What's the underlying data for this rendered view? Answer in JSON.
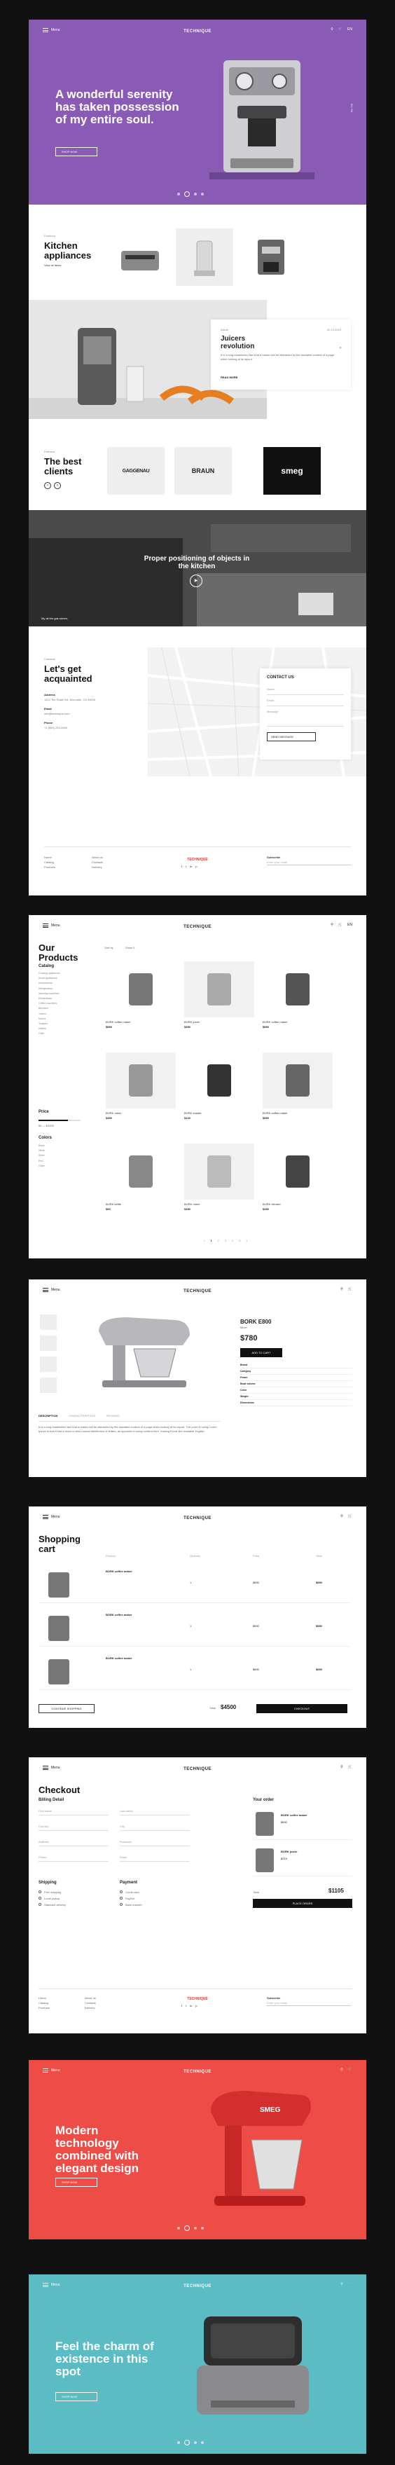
{
  "colors": {
    "purple": "#8a5bb5",
    "red": "#ee4c47",
    "teal": "#5bbcc4",
    "dark": "#111111",
    "accent_red": "#e53935"
  },
  "nav": {
    "logo": "TECHNIQUE",
    "menu": "Menu",
    "search_icon": "search-icon",
    "cart_icon": "cart-icon",
    "cart_count": "2",
    "lang": "EN"
  },
  "hero1": {
    "title": "A wonderful serenity has taken possession of my entire soul.",
    "button": "SHOP NOW",
    "counter": "01 / 04"
  },
  "kitchen": {
    "eyebrow": "Featured",
    "title": "Kitchen appliances",
    "link": "View all items"
  },
  "juicers": {
    "eyebrow": "Article",
    "date": "02.10.2019",
    "title": "Juicers revolution",
    "text": "It is a long established fact that a reader will be distracted by the readable content of a page when looking at its layout.",
    "link": "READ MORE"
  },
  "clients": {
    "eyebrow": "Partners",
    "title": "The best clients",
    "logos": [
      "GAGGENAU",
      "BRAUN",
      "smeg"
    ]
  },
  "kitchen_banner": {
    "title": "Proper positioning of objects in the kitchen",
    "caption": "My all the gas stoves"
  },
  "contact": {
    "eyebrow": "Contacts",
    "title": "Let's get acquainted",
    "address_h": "Address",
    "address": "1412 Tim Road Hot, Mountain, CA 94000",
    "email_h": "Email",
    "email": "info@technique.com",
    "phone_h": "Phone",
    "phone": "+1 (650) 253-0000",
    "form_title": "CONTACT US",
    "fields": [
      "Name",
      "Email",
      "Message"
    ],
    "send": "SEND MESSAGE"
  },
  "footer": {
    "col1": [
      "Home",
      "Catalog",
      "Products"
    ],
    "col2": [
      "About us",
      "Contacts",
      "Delivery"
    ],
    "logo": "TECHNIQUE",
    "social": [
      "f",
      "t",
      "in",
      "p"
    ],
    "subscribe": "Subscribe",
    "email_placeholder": "Enter your email"
  },
  "catalog": {
    "title": "Our Products",
    "sort": "Sort by",
    "view": "Show 9",
    "catalog_h": "Catalog",
    "categories": [
      "Cooking appliances",
      "Small appliances",
      "Dishwashers",
      "Refrigerators",
      "Washing machines",
      "Kitchenware",
      "Coffee machines",
      "Blenders",
      "Juicers",
      "Mixers",
      "Toasters",
      "Kettles",
      "Grills"
    ],
    "brands_h": "Brand",
    "price_h": "Price",
    "price_range": "$0 — $1000",
    "colors_h": "Colors",
    "colors": [
      "Black",
      "White",
      "Silver",
      "Red",
      "Other"
    ],
    "products": [
      {
        "name": "BORK coffee maker",
        "price": "$890"
      },
      {
        "name": "BORK juicer",
        "price": "$350"
      },
      {
        "name": "BORK coffee maker",
        "price": "$890"
      },
      {
        "name": "BORK mixer",
        "price": "$450"
      },
      {
        "name": "BORK toaster",
        "price": "$120"
      },
      {
        "name": "BORK coffee maker",
        "price": "$890"
      },
      {
        "name": "BORK kettle",
        "price": "$90"
      },
      {
        "name": "BORK mixer",
        "price": "$450"
      },
      {
        "name": "BORK blender",
        "price": "$290"
      }
    ],
    "pages": [
      "1",
      "2",
      "3",
      "4",
      "5"
    ]
  },
  "product": {
    "name": "BORK E800",
    "code": "Mixer",
    "price": "$780",
    "add_button": "ADD TO CART",
    "tabs": [
      "DESCRIPTION",
      "CHARACTERISTICS",
      "REVIEWS"
    ],
    "description": "It is a long established fact that a reader will be distracted by the readable content of a page when looking at its layout. The point of using Lorem Ipsum is that it has a more-or-less normal distribution of letters, as opposed to using content here, making it look like readable English.",
    "specs": [
      "Brand",
      "Category",
      "Power",
      "Bowl volume",
      "Color",
      "Weight",
      "Dimensions"
    ]
  },
  "cart": {
    "title": "Shopping cart",
    "columns": [
      "Product",
      "Quantity",
      "Price",
      "Total"
    ],
    "items": [
      {
        "name": "BORK coffee maker",
        "qty": "1",
        "price": "$890",
        "total": "$890"
      },
      {
        "name": "BORK coffee maker",
        "qty": "1",
        "price": "$890",
        "total": "$890"
      },
      {
        "name": "BORK coffee maker",
        "qty": "1",
        "price": "$890",
        "total": "$890"
      }
    ],
    "continue": "CONTINUE SHOPPING",
    "total_label": "Total:",
    "total": "$4500",
    "checkout": "CHECKOUT"
  },
  "checkout": {
    "title": "Checkout",
    "billing": "Billing Detail",
    "fields": [
      "First name",
      "Last name",
      "Country",
      "City",
      "Address",
      "Postcode",
      "Phone",
      "Email"
    ],
    "shipping_h": "Shipping",
    "shipping": [
      "Free shipping",
      "Local pickup",
      "Standard delivery"
    ],
    "payment_h": "Payment",
    "payment": [
      "Credit card",
      "PayPal",
      "Bank transfer"
    ],
    "order_h": "Your order",
    "order_items": [
      {
        "name": "BORK coffee maker",
        "price": "$890"
      },
      {
        "name": "BORK juicer",
        "price": "$215"
      }
    ],
    "total_label": "Total:",
    "total": "$1105",
    "place": "PLACE ORDER"
  },
  "hero2": {
    "title": "Modern technology combined with elegant design",
    "button": "SHOP NOW"
  },
  "hero3": {
    "title": "Feel the charm of existence in this spot",
    "button": "SHOP NOW"
  }
}
